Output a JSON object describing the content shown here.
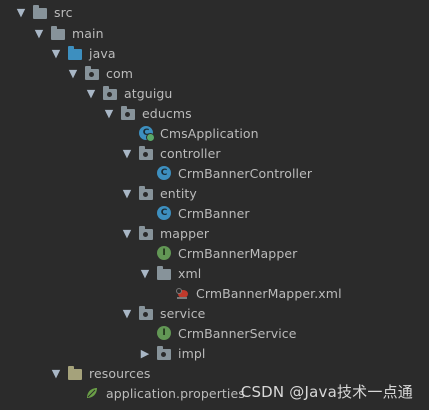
{
  "tree": {
    "items": [
      {
        "label": "src"
      },
      {
        "label": "main"
      },
      {
        "label": "java"
      },
      {
        "label": "com"
      },
      {
        "label": "atguigu"
      },
      {
        "label": "educms"
      },
      {
        "label": "CmsApplication"
      },
      {
        "label": "controller"
      },
      {
        "label": "CrmBannerController"
      },
      {
        "label": "entity"
      },
      {
        "label": "CrmBanner"
      },
      {
        "label": "mapper"
      },
      {
        "label": "CrmBannerMapper"
      },
      {
        "label": "xml"
      },
      {
        "label": "CrmBannerMapper.xml"
      },
      {
        "label": "service"
      },
      {
        "label": "CrmBannerService"
      },
      {
        "label": "impl"
      },
      {
        "label": "resources"
      },
      {
        "label": "application.properties"
      }
    ]
  },
  "icons": {
    "expanded": "chevron-down-icon",
    "collapsed": "chevron-right-icon",
    "folder": "folder-icon",
    "package": "package-icon",
    "class": "class-icon",
    "interface": "interface-icon",
    "xml": "xml-file-icon",
    "properties": "properties-file-icon"
  },
  "watermark": {
    "text": "CSDN @Java技术一点通"
  },
  "colors": {
    "background": "#2b2b2b",
    "text": "#bbbbbb",
    "class_icon": "#3d8fbf",
    "interface_icon": "#629755",
    "source_folder": "#3d8fbf",
    "resources_folder": "#a5a27b"
  }
}
